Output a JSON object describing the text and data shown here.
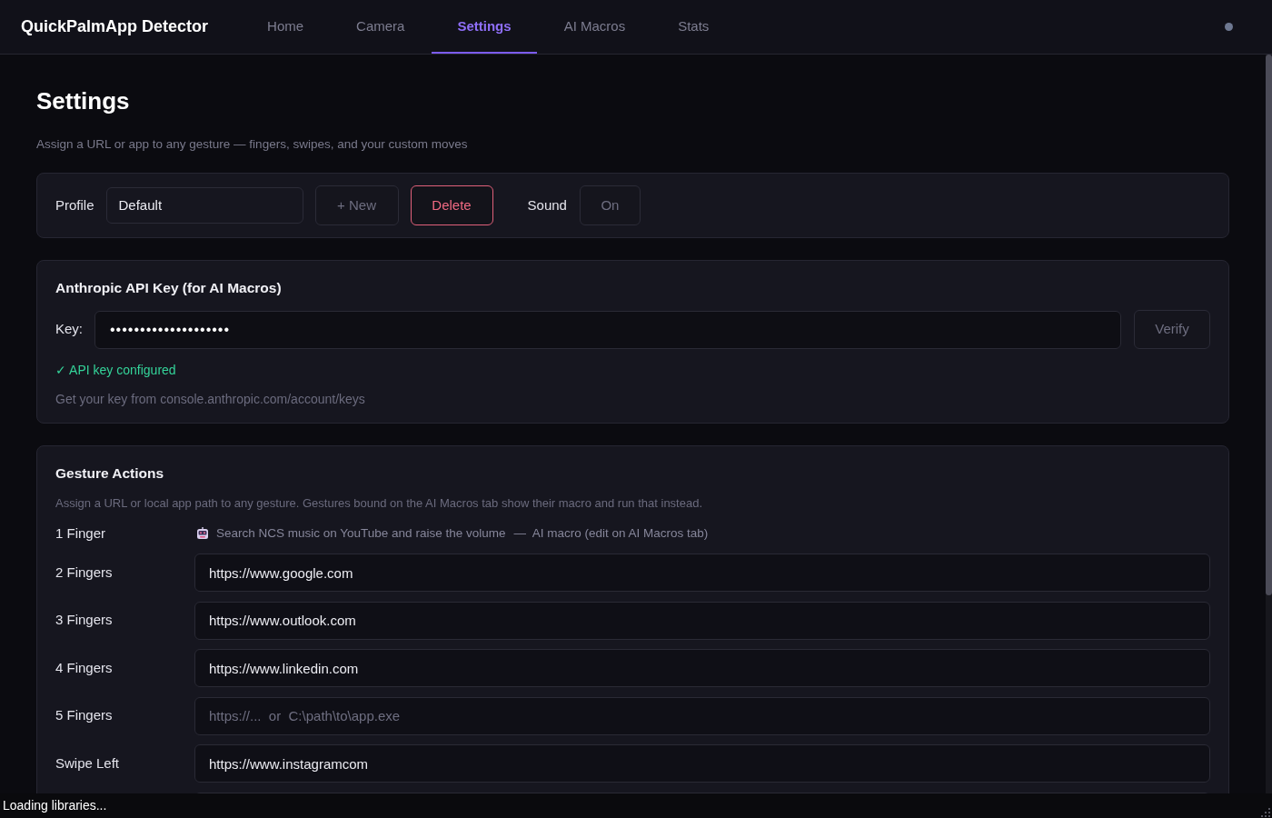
{
  "app": {
    "title": "QuickPalmApp Detector"
  },
  "tabs": [
    {
      "label": "Home",
      "selected": false
    },
    {
      "label": "Camera",
      "selected": false
    },
    {
      "label": "Settings",
      "selected": true
    },
    {
      "label": "AI Macros",
      "selected": false
    },
    {
      "label": "Stats",
      "selected": false
    }
  ],
  "page": {
    "title": "Settings",
    "subtitle": "Assign a URL or app to any gesture — fingers, swipes, and your custom moves"
  },
  "profile_bar": {
    "profile_label": "Profile",
    "profile_value": "Default",
    "new_button": "+ New",
    "delete_button": "Delete",
    "sound_label": "Sound",
    "sound_button": "On"
  },
  "api_key": {
    "title": "Anthropic API Key (for AI Macros)",
    "key_label": "Key:",
    "value": "••••••••••••••••••••",
    "verify_button": "Verify",
    "status": "✓ API key configured",
    "hint": "Get your key from console.anthropic.com/account/keys"
  },
  "gestures": {
    "title": "Gesture Actions",
    "description": "Assign a URL or local app path to any gesture. Gestures bound on the AI Macros tab show their macro and run that instead.",
    "items": [
      {
        "label": "1 Finger",
        "kind": "macro",
        "macro": "Search NCS music on YouTube and raise the volume",
        "note": "—  AI macro (edit on AI Macros tab)"
      },
      {
        "label": "2 Fingers",
        "kind": "url",
        "value": "https://www.google.com"
      },
      {
        "label": "3 Fingers",
        "kind": "url",
        "value": "https://www.outlook.com"
      },
      {
        "label": "4 Fingers",
        "kind": "url",
        "value": "https://www.linkedin.com"
      },
      {
        "label": "5 Fingers",
        "kind": "url",
        "placeholder": "https://...  or  C:\\path\\to\\app.exe"
      },
      {
        "label": "Swipe Left",
        "kind": "url",
        "value": "https://www.instagramcom"
      },
      {
        "kind": "url"
      }
    ]
  },
  "status_bar": {
    "text": "Loading libraries..."
  }
}
